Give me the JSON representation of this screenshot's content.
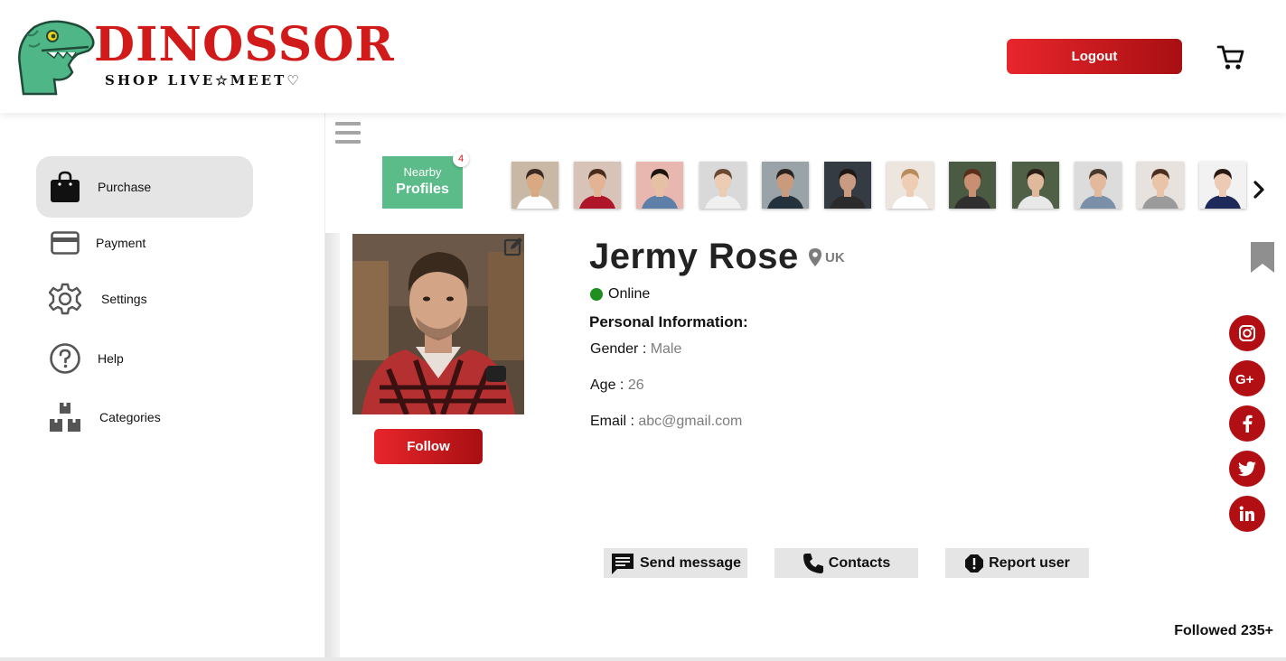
{
  "brand": {
    "name": "DINOSSOR",
    "tagline": "SHOP LIVE☆MEET♡"
  },
  "header": {
    "logout_label": "Logout",
    "cart_icon": "cart-icon"
  },
  "sidebar": {
    "items": [
      {
        "label": "Purchase",
        "icon": "shopping-bag-icon",
        "active": true
      },
      {
        "label": "Payment",
        "icon": "credit-card-icon"
      },
      {
        "label": "Settings",
        "icon": "gear-icon"
      },
      {
        "label": "Help",
        "icon": "question-icon"
      },
      {
        "label": "Categories",
        "icon": "boxes-icon"
      }
    ]
  },
  "nearby": {
    "line1": "Nearby",
    "line2": "Profiles",
    "count": "4",
    "accent": "#5bbc89"
  },
  "thumbnails": [
    {
      "bg": "#c9b8a6",
      "skin": "#d9a982",
      "hair": "#3b2a1f",
      "shirt": "#ffffff"
    },
    {
      "bg": "#d8c3b8",
      "skin": "#e2b394",
      "hair": "#4a2b1a",
      "shirt": "#b0162a"
    },
    {
      "bg": "#e7b7b0",
      "skin": "#e6c0a2",
      "hair": "#1d1410",
      "shirt": "#5d7fa8"
    },
    {
      "bg": "#d9d9d9",
      "skin": "#ecccb4",
      "hair": "#6b4a32",
      "shirt": "#f0f0f0"
    },
    {
      "bg": "#9aa3a8",
      "skin": "#c99b7c",
      "hair": "#2a2320",
      "shirt": "#24323e"
    },
    {
      "bg": "#353b42",
      "skin": "#c99b80",
      "hair": "#1f1814",
      "shirt": "#2b2b2b"
    },
    {
      "bg": "#ece6df",
      "skin": "#efcdb4",
      "hair": "#b88a5c",
      "shirt": "#ffffff"
    },
    {
      "bg": "#4b5a43",
      "skin": "#c98f73",
      "hair": "#5a2e1a",
      "shirt": "#2f2f2f"
    },
    {
      "bg": "#506047",
      "skin": "#e0b89c",
      "hair": "#2b1d16",
      "shirt": "#e8e8e8"
    },
    {
      "bg": "#dcdcdc",
      "skin": "#e2b99c",
      "hair": "#4a3a2e",
      "shirt": "#7a8fa8"
    },
    {
      "bg": "#e7e2dd",
      "skin": "#eac4a9",
      "hair": "#4d2f22",
      "shirt": "#9b9b9b"
    },
    {
      "bg": "#f2f2f2",
      "skin": "#eccab3",
      "hair": "#2a1812",
      "shirt": "#1d2a5a"
    }
  ],
  "profile": {
    "name": "Jermy Rose",
    "location": "UK",
    "status": "Online",
    "status_color": "#1e8f1e",
    "section_title": "Personal Information:",
    "gender_label": "Gender : ",
    "gender": "Male",
    "age_label": "Age : ",
    "age": "26",
    "email_label": "Email : ",
    "email": "abc@gmail.com",
    "follow_label": "Follow",
    "followed_text": "Followed 235+"
  },
  "social": [
    "instagram-icon",
    "google-plus-icon",
    "facebook-icon",
    "twitter-icon",
    "linkedin-icon"
  ],
  "actions": [
    {
      "label": "Send message",
      "icon": "message-icon"
    },
    {
      "label": "Contacts",
      "icon": "phone-icon"
    },
    {
      "label": "Report user",
      "icon": "report-icon"
    }
  ],
  "colors": {
    "accent_red": "#d11a1a",
    "button_red_start": "#e8262c",
    "button_red_end": "#a80f12",
    "social_red": "#b10f14"
  }
}
